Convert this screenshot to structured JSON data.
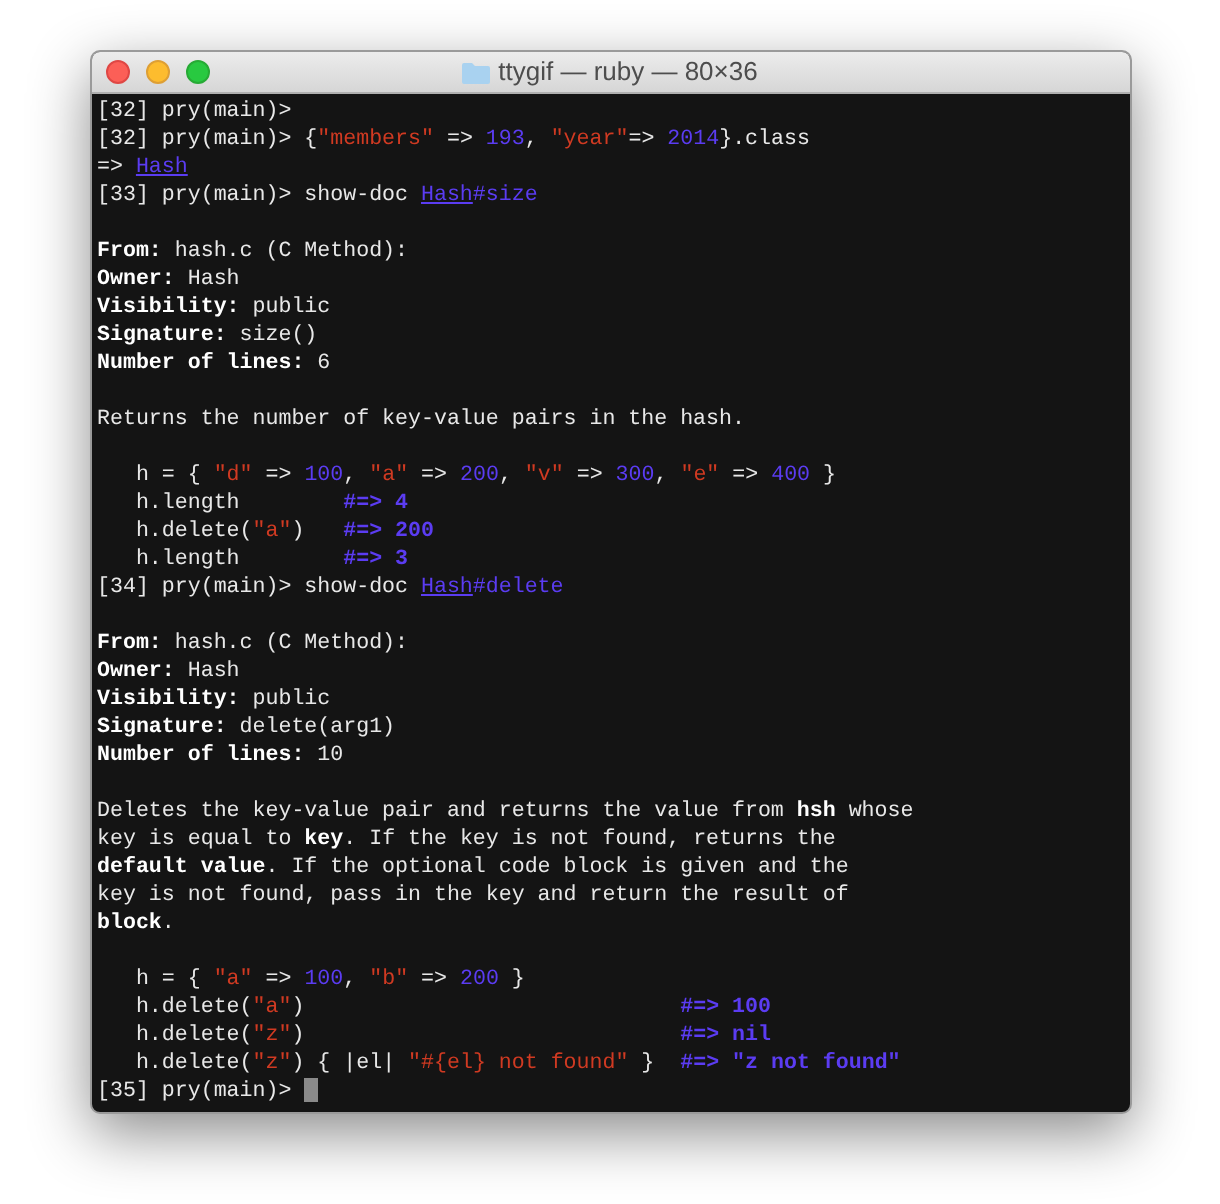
{
  "window": {
    "title": "ttygif — ruby — 80×36"
  },
  "terminal": {
    "lines": [
      {
        "kind": "text",
        "segments": [
          {
            "kind": "text",
            "text": "[32] pry(main)>"
          }
        ]
      },
      {
        "kind": "text",
        "segments": [
          {
            "kind": "text",
            "text": "[32] pry(main)> {"
          },
          {
            "kind": "string",
            "text": "\"members\""
          },
          {
            "kind": "text",
            "text": " => "
          },
          {
            "kind": "number",
            "text": "193"
          },
          {
            "kind": "text",
            "text": ", "
          },
          {
            "kind": "string",
            "text": "\"year\""
          },
          {
            "kind": "text",
            "text": "=> "
          },
          {
            "kind": "number",
            "text": "2014"
          },
          {
            "kind": "text",
            "text": "}.class"
          }
        ]
      },
      {
        "kind": "text",
        "segments": [
          {
            "kind": "text",
            "text": "=> "
          },
          {
            "kind": "link",
            "text": "Hash"
          }
        ]
      },
      {
        "kind": "text",
        "segments": [
          {
            "kind": "text",
            "text": "[33] pry(main)> show-doc "
          },
          {
            "kind": "link",
            "text": "Hash"
          },
          {
            "kind": "number",
            "text": "#size"
          }
        ]
      },
      {
        "kind": "blank"
      },
      {
        "kind": "text",
        "segments": [
          {
            "kind": "bold",
            "text": "From:"
          },
          {
            "kind": "text",
            "text": " hash.c (C Method):"
          }
        ]
      },
      {
        "kind": "text",
        "segments": [
          {
            "kind": "bold",
            "text": "Owner:"
          },
          {
            "kind": "text",
            "text": " Hash"
          }
        ]
      },
      {
        "kind": "text",
        "segments": [
          {
            "kind": "bold",
            "text": "Visibility:"
          },
          {
            "kind": "text",
            "text": " public"
          }
        ]
      },
      {
        "kind": "text",
        "segments": [
          {
            "kind": "bold",
            "text": "Signature:"
          },
          {
            "kind": "text",
            "text": " size()"
          }
        ]
      },
      {
        "kind": "text",
        "segments": [
          {
            "kind": "bold",
            "text": "Number of lines:"
          },
          {
            "kind": "text",
            "text": " 6"
          }
        ]
      },
      {
        "kind": "blank"
      },
      {
        "kind": "text",
        "segments": [
          {
            "kind": "text",
            "text": "Returns the number of key-value pairs in the hash."
          }
        ]
      },
      {
        "kind": "blank"
      },
      {
        "kind": "text",
        "segments": [
          {
            "kind": "text",
            "text": "   h = { "
          },
          {
            "kind": "string",
            "text": "\"d\""
          },
          {
            "kind": "text",
            "text": " => "
          },
          {
            "kind": "number",
            "text": "100"
          },
          {
            "kind": "text",
            "text": ", "
          },
          {
            "kind": "string",
            "text": "\"a\""
          },
          {
            "kind": "text",
            "text": " => "
          },
          {
            "kind": "number",
            "text": "200"
          },
          {
            "kind": "text",
            "text": ", "
          },
          {
            "kind": "string",
            "text": "\"v\""
          },
          {
            "kind": "text",
            "text": " => "
          },
          {
            "kind": "number",
            "text": "300"
          },
          {
            "kind": "text",
            "text": ", "
          },
          {
            "kind": "string",
            "text": "\"e\""
          },
          {
            "kind": "text",
            "text": " => "
          },
          {
            "kind": "number",
            "text": "400"
          },
          {
            "kind": "text",
            "text": " }"
          }
        ]
      },
      {
        "kind": "text",
        "segments": [
          {
            "kind": "text",
            "text": "   h.length        "
          },
          {
            "kind": "comment",
            "text": "#=> 4"
          }
        ]
      },
      {
        "kind": "text",
        "segments": [
          {
            "kind": "text",
            "text": "   h.delete("
          },
          {
            "kind": "string",
            "text": "\"a\""
          },
          {
            "kind": "text",
            "text": ")   "
          },
          {
            "kind": "comment",
            "text": "#=> 200"
          }
        ]
      },
      {
        "kind": "text",
        "segments": [
          {
            "kind": "text",
            "text": "   h.length        "
          },
          {
            "kind": "comment",
            "text": "#=> 3"
          }
        ]
      },
      {
        "kind": "text",
        "segments": [
          {
            "kind": "text",
            "text": "[34] pry(main)> show-doc "
          },
          {
            "kind": "link",
            "text": "Hash"
          },
          {
            "kind": "number",
            "text": "#delete"
          }
        ]
      },
      {
        "kind": "blank"
      },
      {
        "kind": "text",
        "segments": [
          {
            "kind": "bold",
            "text": "From:"
          },
          {
            "kind": "text",
            "text": " hash.c (C Method):"
          }
        ]
      },
      {
        "kind": "text",
        "segments": [
          {
            "kind": "bold",
            "text": "Owner:"
          },
          {
            "kind": "text",
            "text": " Hash"
          }
        ]
      },
      {
        "kind": "text",
        "segments": [
          {
            "kind": "bold",
            "text": "Visibility:"
          },
          {
            "kind": "text",
            "text": " public"
          }
        ]
      },
      {
        "kind": "text",
        "segments": [
          {
            "kind": "bold",
            "text": "Signature:"
          },
          {
            "kind": "text",
            "text": " delete(arg1)"
          }
        ]
      },
      {
        "kind": "text",
        "segments": [
          {
            "kind": "bold",
            "text": "Number of lines:"
          },
          {
            "kind": "text",
            "text": " 10"
          }
        ]
      },
      {
        "kind": "blank"
      },
      {
        "kind": "text",
        "segments": [
          {
            "kind": "text",
            "text": "Deletes the key-value pair and returns the value from "
          },
          {
            "kind": "bold",
            "text": "hsh"
          },
          {
            "kind": "text",
            "text": " whose"
          }
        ]
      },
      {
        "kind": "text",
        "segments": [
          {
            "kind": "text",
            "text": "key is equal to "
          },
          {
            "kind": "bold",
            "text": "key"
          },
          {
            "kind": "text",
            "text": ". If the key is not found, returns the"
          }
        ]
      },
      {
        "kind": "text",
        "segments": [
          {
            "kind": "bold",
            "text": "default value"
          },
          {
            "kind": "text",
            "text": ". If the optional code block is given and the"
          }
        ]
      },
      {
        "kind": "text",
        "segments": [
          {
            "kind": "text",
            "text": "key is not found, pass in the key and return the result of"
          }
        ]
      },
      {
        "kind": "text",
        "segments": [
          {
            "kind": "bold",
            "text": "block"
          },
          {
            "kind": "text",
            "text": "."
          }
        ]
      },
      {
        "kind": "blank"
      },
      {
        "kind": "text",
        "segments": [
          {
            "kind": "text",
            "text": "   h = { "
          },
          {
            "kind": "string",
            "text": "\"a\""
          },
          {
            "kind": "text",
            "text": " => "
          },
          {
            "kind": "number",
            "text": "100"
          },
          {
            "kind": "text",
            "text": ", "
          },
          {
            "kind": "string",
            "text": "\"b\""
          },
          {
            "kind": "text",
            "text": " => "
          },
          {
            "kind": "number",
            "text": "200"
          },
          {
            "kind": "text",
            "text": " }"
          }
        ]
      },
      {
        "kind": "text",
        "segments": [
          {
            "kind": "text",
            "text": "   h.delete("
          },
          {
            "kind": "string",
            "text": "\"a\""
          },
          {
            "kind": "text",
            "text": ")                             "
          },
          {
            "kind": "comment",
            "text": "#=> 100"
          }
        ]
      },
      {
        "kind": "text",
        "segments": [
          {
            "kind": "text",
            "text": "   h.delete("
          },
          {
            "kind": "string",
            "text": "\"z\""
          },
          {
            "kind": "text",
            "text": ")                             "
          },
          {
            "kind": "comment",
            "text": "#=> nil"
          }
        ]
      },
      {
        "kind": "text",
        "segments": [
          {
            "kind": "text",
            "text": "   h.delete("
          },
          {
            "kind": "string",
            "text": "\"z\""
          },
          {
            "kind": "text",
            "text": ") { |el| "
          },
          {
            "kind": "string",
            "text": "\"#{el} not found\""
          },
          {
            "kind": "text",
            "text": " }  "
          },
          {
            "kind": "comment",
            "text": "#=> \"z not found\""
          }
        ]
      },
      {
        "kind": "text",
        "segments": [
          {
            "kind": "text",
            "text": "[35] pry(main)> "
          },
          {
            "kind": "cursor"
          }
        ]
      }
    ]
  }
}
